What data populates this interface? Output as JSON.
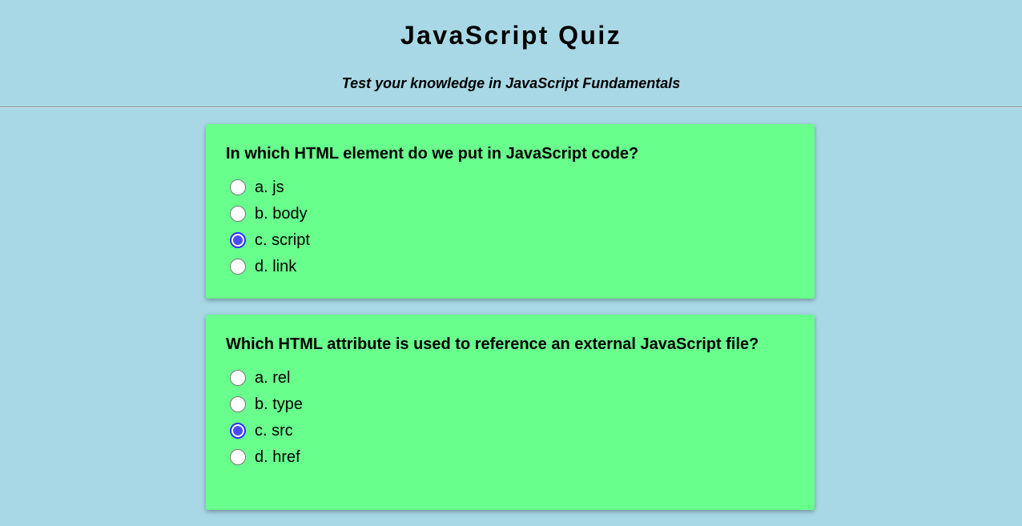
{
  "header": {
    "title": "JavaScript Quiz",
    "subtitle": "Test your knowledge in JavaScript Fundamentals"
  },
  "questions": [
    {
      "text": "In which HTML element do we put in JavaScript code?",
      "options": [
        "a. js",
        "b. body",
        "c. script",
        "d. link"
      ],
      "selected": "c. script"
    },
    {
      "text": "Which HTML attribute is used to reference an external JavaScript file?",
      "options": [
        "a. rel",
        "b. type",
        "c. src",
        "d. href"
      ],
      "selected": "c. src"
    }
  ],
  "colors": {
    "background": "#a8d8e6",
    "card": "#69ff8c",
    "radio_selected": "#4a4aff"
  }
}
